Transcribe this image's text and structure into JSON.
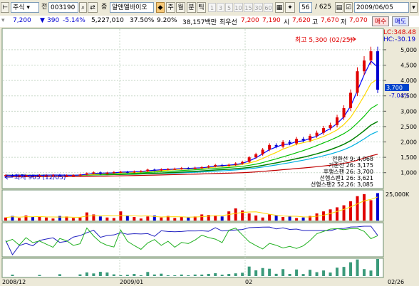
{
  "toolbar": {
    "market_label": "주식",
    "code_prefix": "전",
    "stock_code": "003190",
    "name_prefix": "증",
    "stock_name": "알앤엘바이오",
    "period_buttons": [
      "주",
      "월",
      "분",
      "틱"
    ],
    "interval_buttons": [
      "1",
      "3",
      "5",
      "10",
      "15",
      "30",
      "60"
    ],
    "count_value": "56",
    "count_total": "/ 625",
    "date": "2009/06/05"
  },
  "info": {
    "price": "7,200",
    "change": "390",
    "change_pct": "-5.14%",
    "volume": "5,227,010",
    "turnover_pct": "37.50%",
    "pct2": "9.20%",
    "amount": "38,157백만",
    "bid_label": "최우선",
    "bid1": "7,200",
    "bid2": "7,190",
    "open_label": "시",
    "open": "7,620",
    "high_label": "고",
    "high": "7,670",
    "low_label": "저",
    "low": "7,070",
    "buy_label": "매수",
    "sell_label": "매도"
  },
  "chart": {
    "price_axis_ticks": [
      "5,000",
      "4,500",
      "4,000",
      "3,500",
      "3,000",
      "2,500",
      "2,000",
      "1,500",
      "1,000"
    ],
    "lc_label": "LC:348.48",
    "hc_label": "HC:-30.19",
    "current_price_tag": "3,700",
    "current_pct_tag": "-7.04%",
    "max_annotation": "최고 5,300 (02/25)",
    "min_annotation": "최저 905 (12/05)",
    "volume_axis_label": "25,000K",
    "date_labels": [
      "2008/12",
      "2009/01",
      "02",
      "02/26"
    ],
    "legend": [
      {
        "text": "전환선 9: 4,068",
        "color": "#ff2020"
      },
      {
        "text": "기준선 26: 3,175",
        "color": "#20a020"
      },
      {
        "text": "후행스팬 26: 3,700",
        "color": "#e08000"
      },
      {
        "text": "선행스팬1 26: 3,621",
        "color": "#ff80ff"
      },
      {
        "text": "선행스팬2 52,26: 3,085",
        "color": "#8080ff"
      }
    ],
    "colors": {
      "up": "#e00000",
      "down": "#0000d0",
      "bg": "#ffffff",
      "grid": "#c8d8c8",
      "ma1": "#0000ff",
      "ma2": "#ffd800",
      "ma3": "#00c000",
      "ma4": "#008000",
      "ma5": "#00b0e0",
      "ma6": "#c00000",
      "ma7": "#606060"
    }
  },
  "chart_data": {
    "type": "candlestick",
    "closes": [
      920,
      905,
      912,
      915,
      908,
      920,
      925,
      930,
      910,
      915,
      922,
      940,
      980,
      1010,
      960,
      1000,
      1020,
      1030,
      1015,
      1040,
      1050,
      1100,
      1080,
      1110,
      1120,
      1130,
      1150,
      1140,
      1160,
      1180,
      1210,
      1250,
      1230,
      1260,
      1300,
      1350,
      1500,
      1600,
      1750,
      1900,
      1850,
      2000,
      1950,
      2100,
      2050,
      2200,
      2300,
      2450,
      2550,
      2800,
      3100,
      3600,
      4300,
      4650,
      4950,
      3700
    ],
    "volumes": [
      3000,
      4500,
      2500,
      5000,
      3500,
      4000,
      3000,
      2000,
      4500,
      4000,
      2500,
      3000,
      8000,
      6000,
      4000,
      3000,
      2500,
      9000,
      5000,
      3500,
      2000,
      4000,
      5000,
      3000,
      4500,
      2500,
      3500,
      3000,
      4000,
      6000,
      5500,
      5000,
      4000,
      9000,
      12000,
      10000,
      7000,
      5000,
      3000,
      6000,
      5000,
      3500,
      4000,
      2500,
      3000,
      4500,
      7000,
      9000,
      11000,
      13000,
      15000,
      19000,
      24000,
      26000,
      20000,
      27000
    ],
    "ylim": [
      600,
      5600
    ]
  }
}
